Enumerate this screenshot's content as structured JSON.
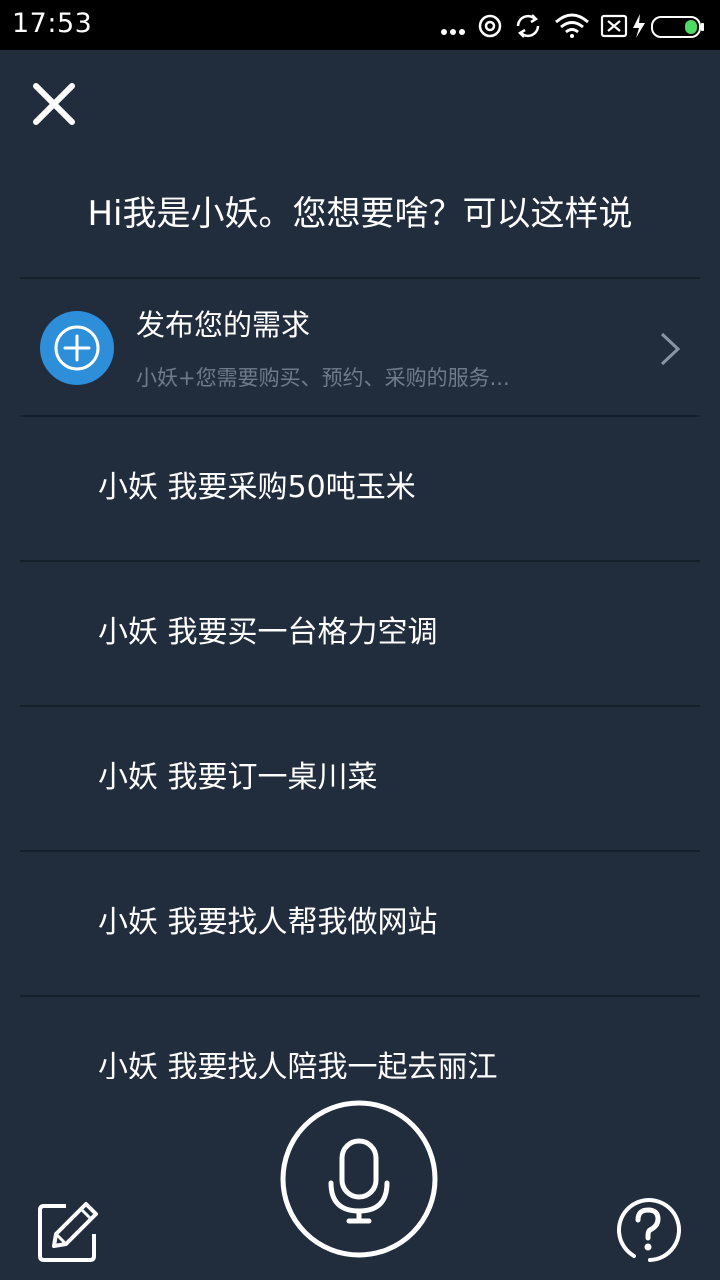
{
  "status_bar": {
    "time": "17:53",
    "icons": [
      "more-dots-icon",
      "alarm-icon",
      "sync-icon",
      "wifi-icon",
      "sim-card-x-icon",
      "charging-bolt-icon",
      "battery-icon"
    ],
    "battery_color": "#4cd964"
  },
  "header": {
    "close_icon": "close-icon",
    "title": "Hi我是小妖。您想要啥？可以这样说"
  },
  "publish": {
    "icon": "plus-circle-icon",
    "title": "发布您的需求",
    "subtitle": "小妖+您需要购买、预约、采购的服务...",
    "chevron": "chevron-right-icon",
    "accent_color": "#2d8ed9"
  },
  "examples": [
    {
      "text": "小妖 我要采购50吨玉米"
    },
    {
      "text": "小妖 我要买一台格力空调"
    },
    {
      "text": "小妖 我要订一桌川菜"
    },
    {
      "text": "小妖 我要找人帮我做网站"
    },
    {
      "text": "小妖 我要找人陪我一起去丽江"
    }
  ],
  "bottom_bar": {
    "left_icon": "edit-icon",
    "center_icon": "microphone-icon",
    "right_icon": "help-icon"
  },
  "colors": {
    "background": "#212d3d",
    "divider": "#16202c",
    "subtitle_text": "#6f7b8b"
  }
}
